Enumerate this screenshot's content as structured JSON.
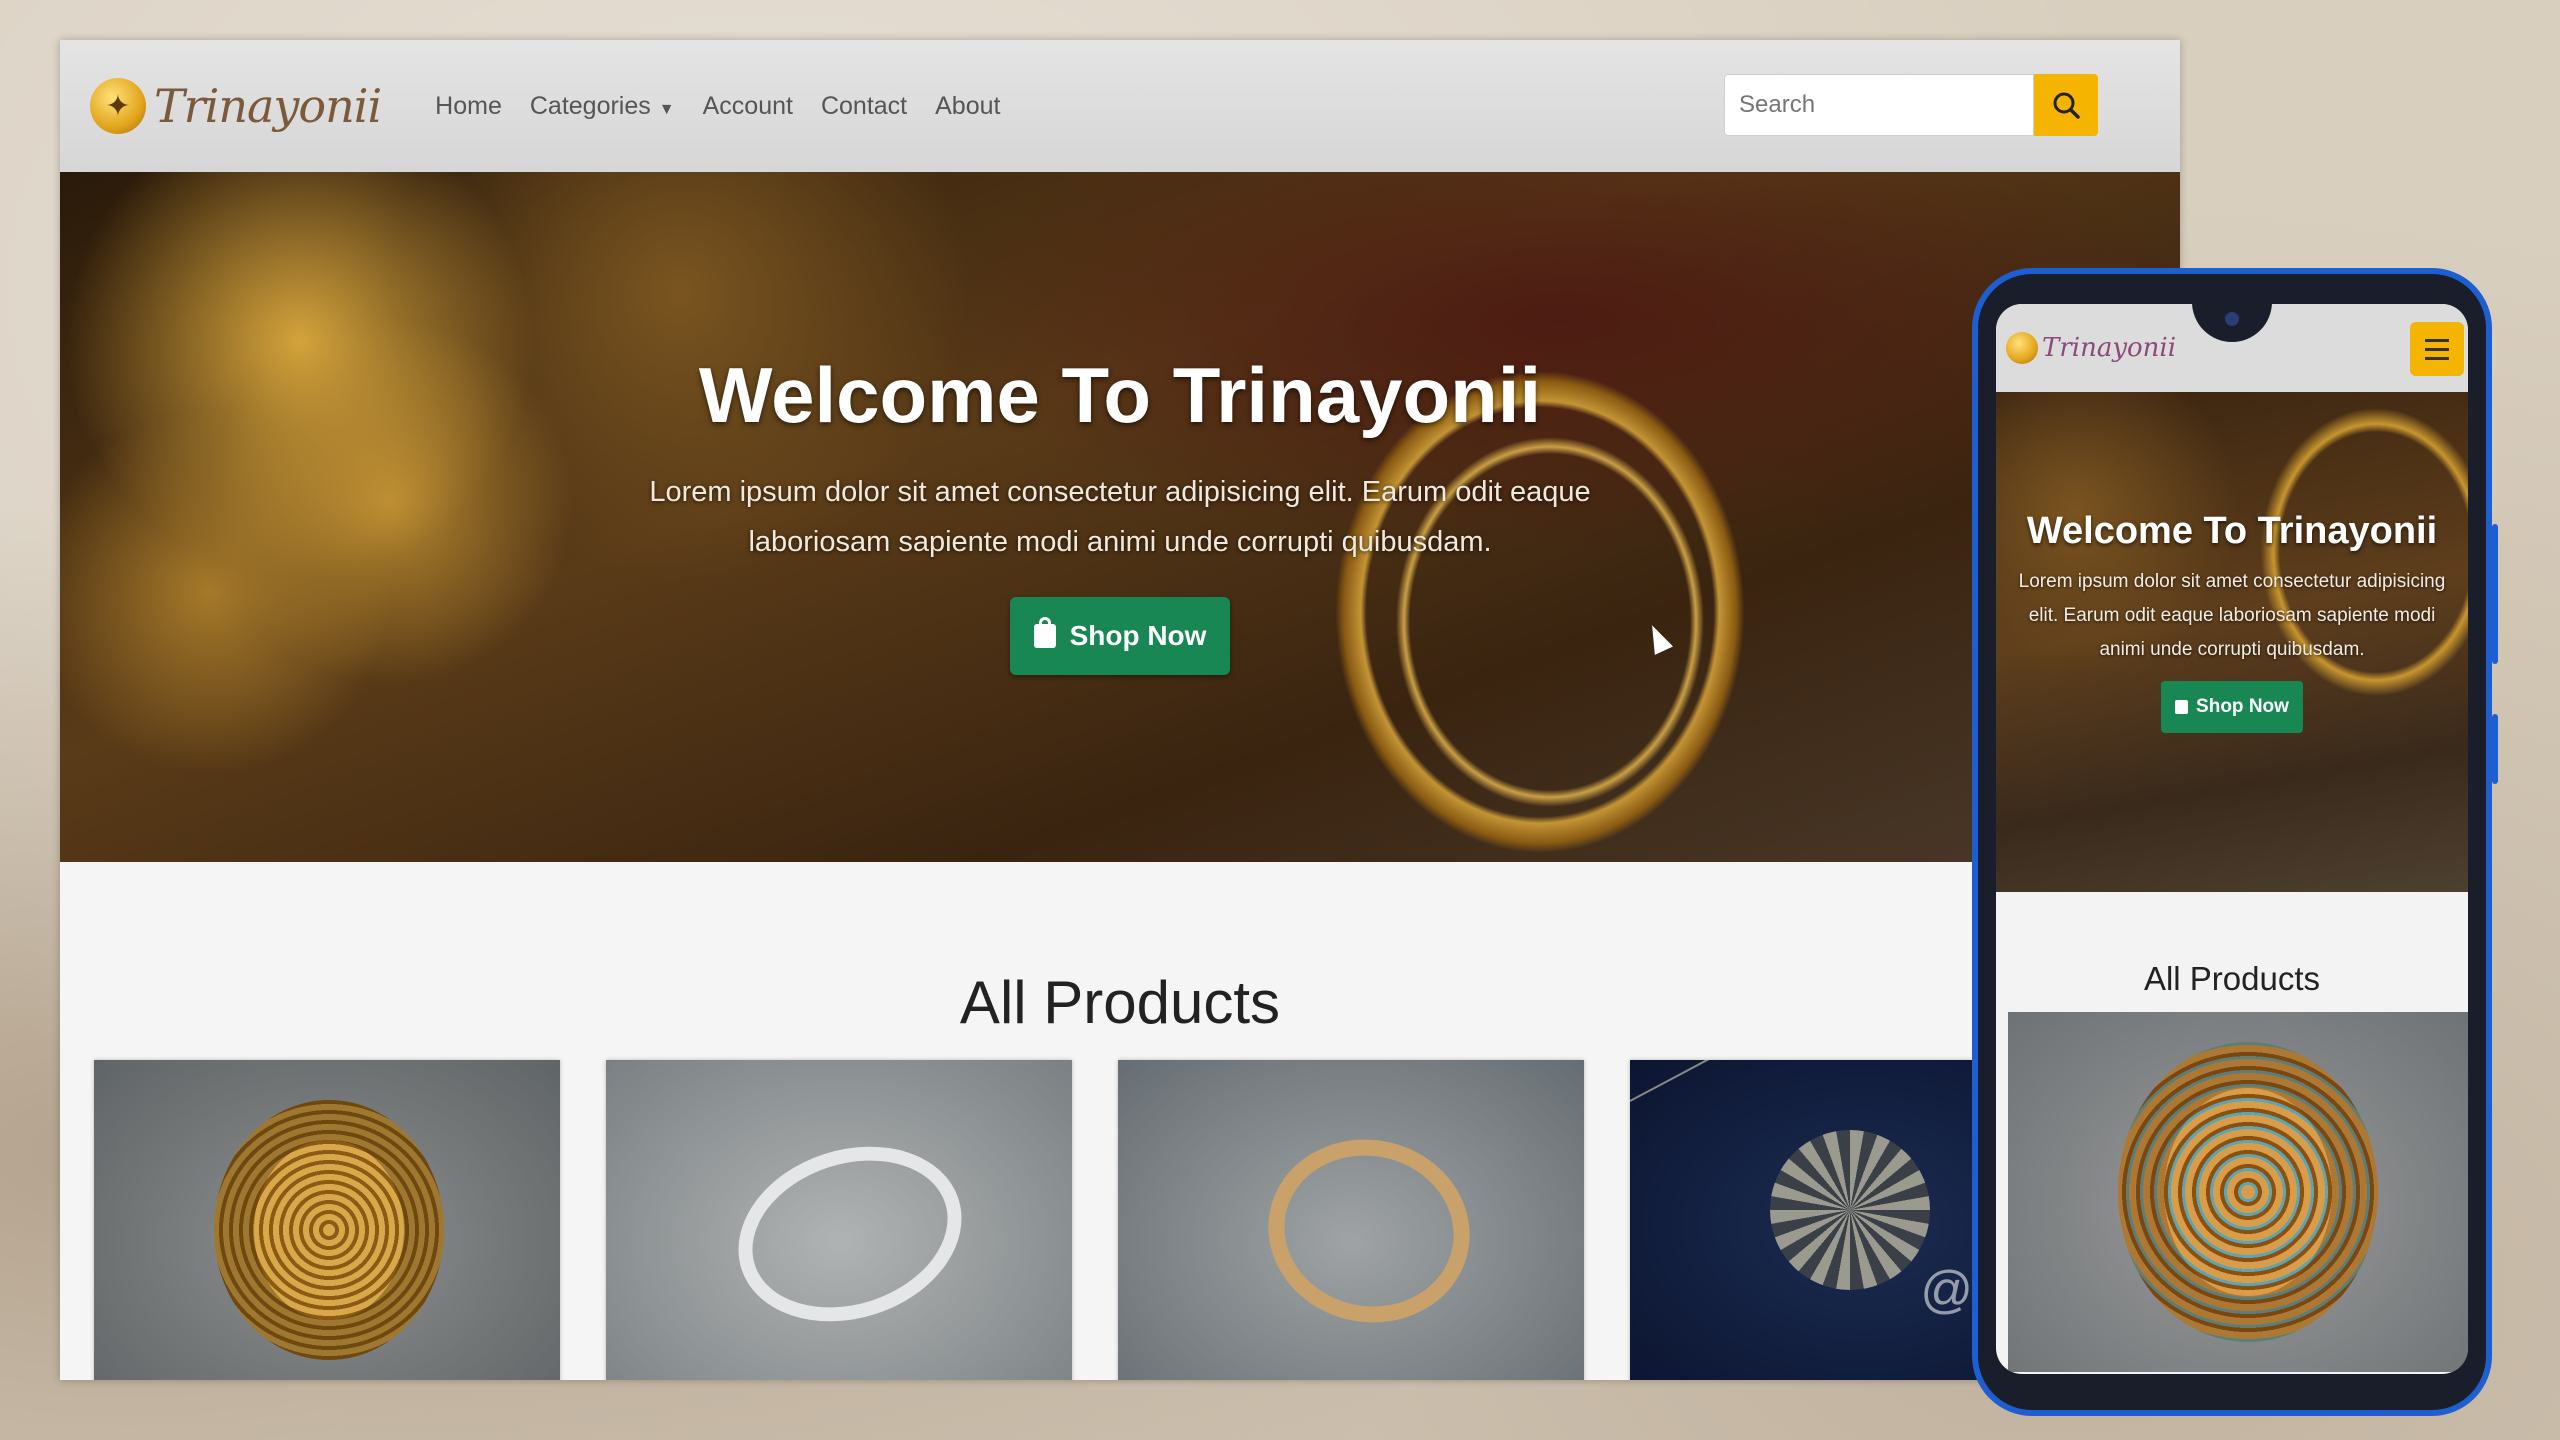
{
  "desktop": {
    "brand": "Trinayonii",
    "nav": [
      {
        "label": "Home"
      },
      {
        "label": "Categories"
      },
      {
        "label": "Account"
      },
      {
        "label": "Contact"
      },
      {
        "label": "About"
      }
    ],
    "search": {
      "placeholder": "Search",
      "value": ""
    },
    "hero": {
      "title": "Welcome To Trinayonii",
      "subtitle": "Lorem ipsum dolor sit amet consectetur adipisicing elit. Earum odit eaque laboriosam sapiente modi animi unde corrupti quibusdam.",
      "button": "Shop Now"
    },
    "products_title": "All Products",
    "products": [
      {
        "image": "gold-gemstone-bangle"
      },
      {
        "image": "silver-crossover-ring"
      },
      {
        "image": "gold-crossover-ring"
      },
      {
        "image": "diamond-pendant-necklace",
        "watermark": "@barun"
      }
    ]
  },
  "mobile": {
    "brand": "Trinayonii",
    "hero": {
      "title": "Welcome To Trinayonii",
      "subtitle": "Lorem ipsum dolor sit amet consectetur adipisicing elit. Earum odit eaque laboriosam sapiente modi animi unde corrupti quibusdam.",
      "button": "Shop Now"
    },
    "products_title": "All Products"
  },
  "colors": {
    "accent": "#f4b400",
    "button_green": "#198754",
    "phone_frame": "#1d5fd1"
  },
  "icons": [
    "search-icon",
    "shopping-bag-icon",
    "hamburger-menu-icon",
    "caret-down-icon"
  ]
}
